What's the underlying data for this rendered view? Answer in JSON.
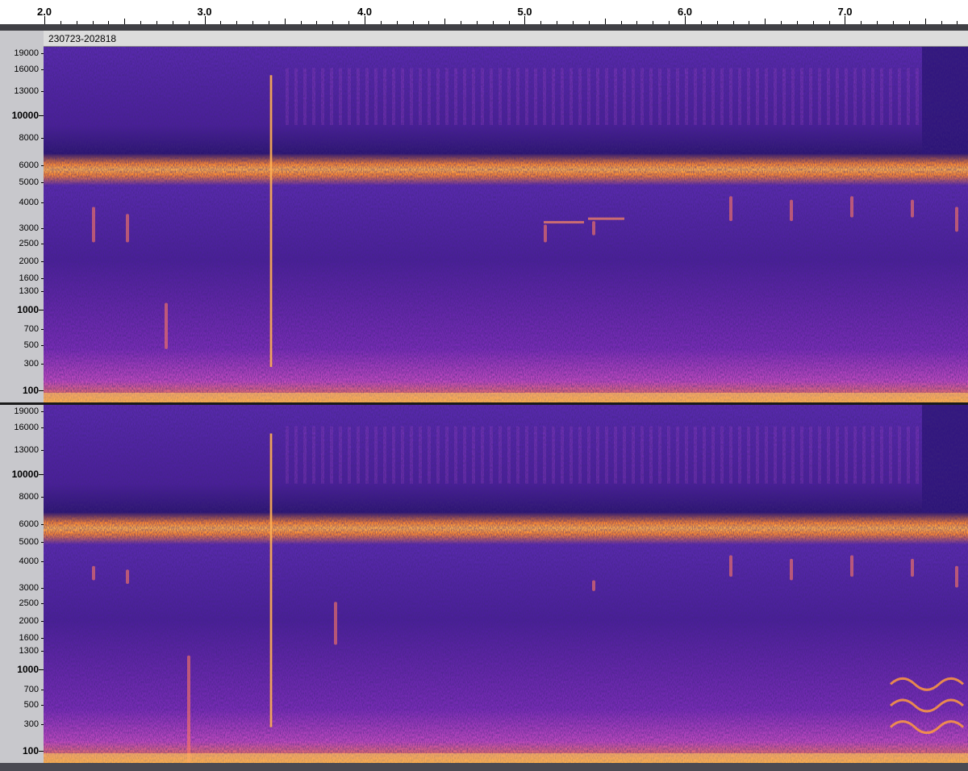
{
  "timeline": {
    "labels": [
      "2.0",
      "3.0",
      "4.0",
      "5.0",
      "6.0",
      "7.0"
    ],
    "start": 2.0,
    "end": 7.77
  },
  "track": {
    "name": "230723-202818"
  },
  "frequency_axis": {
    "labels": [
      "19000",
      "16000",
      "13000",
      "10000",
      "8000",
      "6000",
      "5000",
      "4000",
      "3000",
      "2500",
      "2000",
      "1600",
      "1300",
      "1000",
      "700",
      "500",
      "300",
      "100"
    ],
    "bold_labels": [
      "10000",
      "1000",
      "100"
    ]
  },
  "colormap": {
    "background": "#3a1a8c",
    "mid": "#8a2fc0",
    "hot": "#ff8a30",
    "brightest": "#ffd060"
  },
  "channels": [
    "channel-1",
    "channel-2"
  ]
}
